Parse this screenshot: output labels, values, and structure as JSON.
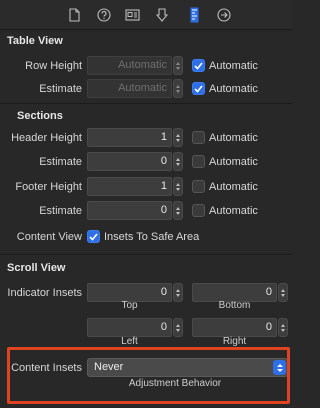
{
  "toolbar": {
    "tabs": [
      {
        "icon": "file-icon",
        "selected": false
      },
      {
        "icon": "help-icon",
        "selected": false
      },
      {
        "icon": "identity-icon",
        "selected": false
      },
      {
        "icon": "attributes-icon",
        "selected": false
      },
      {
        "icon": "size-ruler-icon",
        "selected": true
      },
      {
        "icon": "connections-icon",
        "selected": false
      }
    ],
    "accent": "#2f6fe5"
  },
  "table_view": {
    "title": "Table View",
    "row_height": {
      "label": "Row Height",
      "placeholder": "Automatic",
      "checkbox_label": "Automatic",
      "checked": true
    },
    "estimate": {
      "label": "Estimate",
      "placeholder": "Automatic",
      "checkbox_label": "Automatic",
      "checked": true
    }
  },
  "sections": {
    "title": "Sections",
    "header_height": {
      "label": "Header Height",
      "value": "1",
      "checkbox_label": "Automatic",
      "checked": false
    },
    "header_estimate": {
      "label": "Estimate",
      "value": "0",
      "checkbox_label": "Automatic",
      "checked": false
    },
    "footer_height": {
      "label": "Footer Height",
      "value": "1",
      "checkbox_label": "Automatic",
      "checked": false
    },
    "footer_estimate": {
      "label": "Estimate",
      "value": "0",
      "checkbox_label": "Automatic",
      "checked": false
    },
    "content_view": {
      "label": "Content View",
      "checkbox_label": "Insets To Safe Area",
      "checked": true
    }
  },
  "scroll_view": {
    "title": "Scroll View",
    "indicator_insets": {
      "label": "Indicator Insets",
      "top": {
        "value": "0",
        "label": "Top"
      },
      "bottom": {
        "value": "0",
        "label": "Bottom"
      },
      "left": {
        "value": "0",
        "label": "Left"
      },
      "right": {
        "value": "0",
        "label": "Right"
      }
    },
    "content_insets": {
      "label": "Content Insets",
      "value": "Never",
      "sublabel": "Adjustment Behavior"
    },
    "highlight_color": "#e0431f"
  }
}
